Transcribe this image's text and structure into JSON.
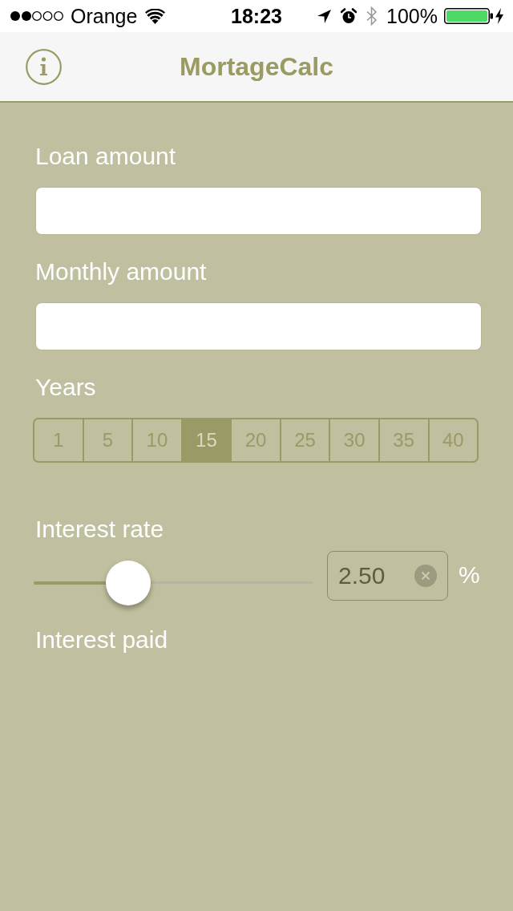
{
  "status_bar": {
    "carrier": "Orange",
    "time": "18:23",
    "battery": "100%"
  },
  "nav_bar": {
    "title": "MortageCalc"
  },
  "fields": [
    {
      "kind": "text_input",
      "label": "Loan amount"
    },
    {
      "kind": "text_input",
      "label": "Monthly amount"
    },
    {
      "kind": "segmented",
      "label": "Years",
      "options": [
        {
          "label": "1",
          "selected": false
        },
        {
          "label": "5",
          "selected": false
        },
        {
          "label": "10",
          "selected": false
        },
        {
          "label": "15",
          "selected": true
        },
        {
          "label": "20",
          "selected": false
        },
        {
          "label": "25",
          "selected": false
        },
        {
          "label": "30",
          "selected": false
        },
        {
          "label": "35",
          "selected": false
        },
        {
          "label": "40",
          "selected": false
        }
      ]
    },
    {
      "kind": "slider",
      "label": "Interest rate",
      "level": 0.34,
      "value": "2.50",
      "unit": "%"
    },
    {
      "kind": "output",
      "label": "Interest paid"
    }
  ]
}
